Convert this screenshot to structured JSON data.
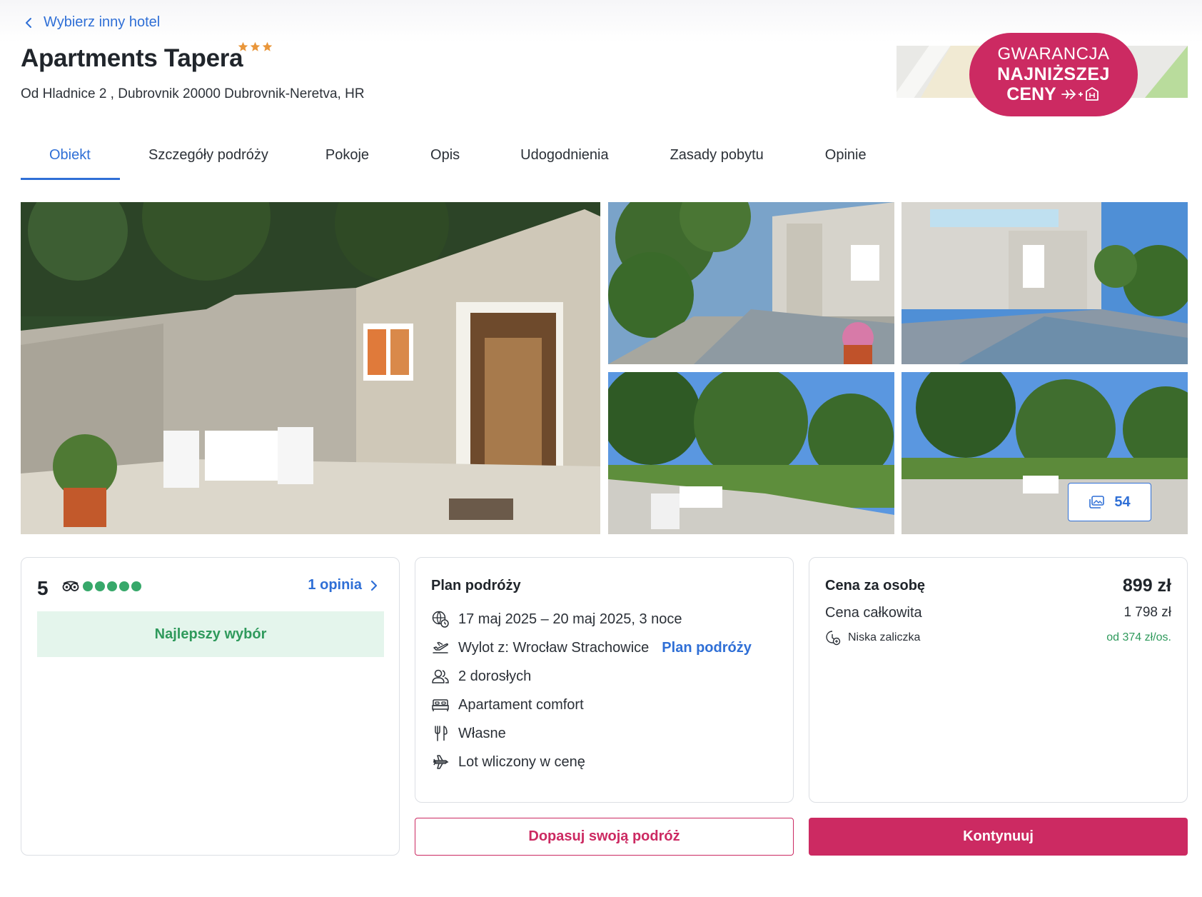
{
  "nav": {
    "back_label": "Wybierz inny hotel"
  },
  "hotel": {
    "name": "Apartments Tapera",
    "stars": 3,
    "address": "Od Hladnice 2 , Dubrovnik 20000 Dubrovnik-Neretva, HR"
  },
  "promo": {
    "line1": "GWARANCJA",
    "line2": "NAJNIŻSZEJ",
    "line3": "CENY"
  },
  "tabs": [
    {
      "label": "Obiekt",
      "active": true
    },
    {
      "label": "Szczegóły podróży"
    },
    {
      "label": "Pokoje"
    },
    {
      "label": "Opis"
    },
    {
      "label": "Udogodnienia"
    },
    {
      "label": "Zasady pobytu"
    },
    {
      "label": "Opinie"
    }
  ],
  "gallery": {
    "photo_count": "54"
  },
  "rating": {
    "score": "5",
    "dots": 5,
    "reviews_label": "1 opinia",
    "badge": "Najlepszy wybór"
  },
  "plan": {
    "title": "Plan podróży",
    "dates": "17 maj 2025 – 20 maj 2025, 3 noce",
    "departure": "Wylot z: Wrocław Strachowice",
    "departure_link": "Plan podróży",
    "guests": "2 dorosłych",
    "room": "Apartament comfort",
    "meals": "Własne",
    "flight": "Lot wliczony w cenę"
  },
  "price": {
    "per_person_label": "Cena za osobę",
    "per_person_value": "899 zł",
    "total_label": "Cena całkowita",
    "total_value": "1 798 zł",
    "deposit_label": "Niska zaliczka",
    "deposit_value": "od 374 zł/os."
  },
  "actions": {
    "customize": "Dopasuj swoją podróż",
    "continue": "Kontynuuj"
  },
  "colors": {
    "accent_blue": "#2f6fd6",
    "brand_pink": "#cc2a62",
    "rating_green": "#37a86a",
    "badge_bg": "#e4f5ec",
    "star_orange": "#e9963a"
  }
}
